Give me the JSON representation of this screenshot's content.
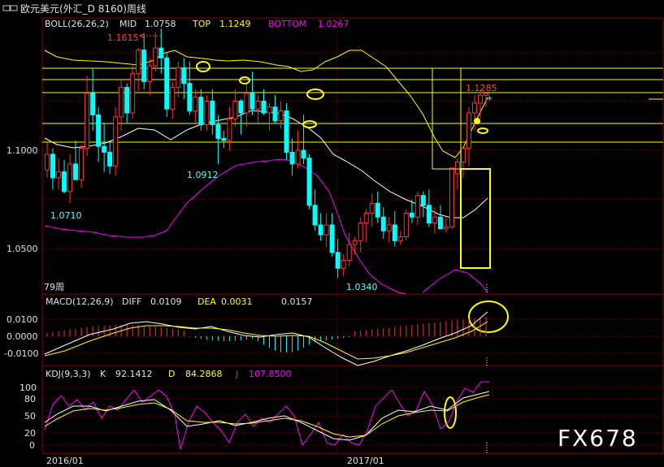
{
  "window": {
    "title": "欧元美元(外汇_D 8160)周线"
  },
  "boll": {
    "label": "BOLL(26,26,2)",
    "mid_label": "MID",
    "mid_value": "1.0758",
    "top_label": "TOP",
    "top_value": "1.1249",
    "bottom_label": "BOTTOM",
    "bottom_value": "1.0267"
  },
  "macd": {
    "label": "MACD(12,26,9)",
    "diff_label": "DIFF",
    "diff_value": "0.0109",
    "dea_label": "DEA",
    "dea_value": "0.0031",
    "macd_value": "0.0157"
  },
  "kdj": {
    "label": "KDJ(9,3,3)",
    "k_label": "K",
    "k_value": "92.1412",
    "d_label": "D",
    "d_value": "84.2868",
    "j_label": "J",
    "j_value": "107.8500"
  },
  "annotations": {
    "high_1": "1.1615",
    "high_2": "1.1285",
    "low_1": "1.0912",
    "low_2": "1.0710",
    "low_3": "1.0340",
    "period_count": "79周"
  },
  "axis": {
    "price_ticks": [
      "1.1000",
      "1.0500"
    ],
    "macd_ticks": [
      "0.0100",
      "0.0000",
      "-0.0100"
    ],
    "kdj_ticks": [
      "100",
      "80",
      "50",
      "20",
      "0"
    ],
    "date_labels": [
      "2016/01",
      "2017/01"
    ]
  },
  "watermark": "FX678",
  "colors": {
    "up": "#ff3232",
    "down": "#00ffff",
    "mid": "#ffffff",
    "top_band": "#ffff00",
    "bottom_band": "#ff00ff",
    "label_cyan": "#54ffff",
    "label_red": "#ff4040",
    "annotation_yellow": "#ffff00"
  },
  "chart_data": {
    "type": "candlestick",
    "title": "欧元美元(外汇_D 8160)周线",
    "period": "weekly",
    "price_ylim": [
      1.02,
      1.17
    ],
    "x_labels": [
      "2016/01",
      "2017/01"
    ],
    "candles": [
      [
        1.09,
        1.104,
        1.086,
        1.098
      ],
      [
        1.098,
        1.101,
        1.08,
        1.086
      ],
      [
        1.086,
        1.096,
        1.08,
        1.089
      ],
      [
        1.089,
        1.095,
        1.078,
        1.079
      ],
      [
        1.079,
        1.098,
        1.073,
        1.093
      ],
      [
        1.093,
        1.105,
        1.085,
        1.085
      ],
      [
        1.085,
        1.103,
        1.081,
        1.101
      ],
      [
        1.101,
        1.138,
        1.097,
        1.129
      ],
      [
        1.129,
        1.142,
        1.11,
        1.118
      ],
      [
        1.118,
        1.122,
        1.094,
        1.102
      ],
      [
        1.102,
        1.114,
        1.089,
        1.099
      ],
      [
        1.099,
        1.104,
        1.088,
        1.092
      ],
      [
        1.092,
        1.122,
        1.087,
        1.117
      ],
      [
        1.117,
        1.136,
        1.11,
        1.132
      ],
      [
        1.132,
        1.134,
        1.114,
        1.119
      ],
      [
        1.119,
        1.144,
        1.116,
        1.139
      ],
      [
        1.139,
        1.152,
        1.13,
        1.151
      ],
      [
        1.151,
        1.159,
        1.131,
        1.135
      ],
      [
        1.135,
        1.147,
        1.128,
        1.143
      ],
      [
        1.143,
        1.16,
        1.14,
        1.152
      ],
      [
        1.152,
        1.162,
        1.139,
        1.147
      ],
      [
        1.147,
        1.15,
        1.117,
        1.121
      ],
      [
        1.121,
        1.135,
        1.116,
        1.132
      ],
      [
        1.132,
        1.145,
        1.127,
        1.142
      ],
      [
        1.142,
        1.147,
        1.126,
        1.134
      ],
      [
        1.134,
        1.145,
        1.118,
        1.12
      ],
      [
        1.12,
        1.131,
        1.114,
        1.127
      ],
      [
        1.127,
        1.131,
        1.11,
        1.113
      ],
      [
        1.113,
        1.128,
        1.11,
        1.125
      ],
      [
        1.125,
        1.131,
        1.108,
        1.113
      ],
      [
        1.113,
        1.118,
        1.093,
        1.106
      ],
      [
        1.106,
        1.11,
        1.101,
        1.105
      ],
      [
        1.105,
        1.122,
        1.1,
        1.116
      ],
      [
        1.116,
        1.131,
        1.112,
        1.125
      ],
      [
        1.125,
        1.126,
        1.108,
        1.119
      ],
      [
        1.119,
        1.134,
        1.112,
        1.129
      ],
      [
        1.129,
        1.14,
        1.118,
        1.121
      ],
      [
        1.121,
        1.128,
        1.113,
        1.125
      ],
      [
        1.125,
        1.131,
        1.118,
        1.119
      ],
      [
        1.119,
        1.124,
        1.11,
        1.122
      ],
      [
        1.122,
        1.128,
        1.114,
        1.115
      ],
      [
        1.115,
        1.125,
        1.111,
        1.12
      ],
      [
        1.12,
        1.124,
        1.095,
        1.099
      ],
      [
        1.099,
        1.106,
        1.087,
        1.093
      ],
      [
        1.093,
        1.11,
        1.091,
        1.1
      ],
      [
        1.1,
        1.118,
        1.093,
        1.096
      ],
      [
        1.096,
        1.098,
        1.07,
        1.072
      ],
      [
        1.072,
        1.08,
        1.059,
        1.062
      ],
      [
        1.062,
        1.068,
        1.054,
        1.057
      ],
      [
        1.057,
        1.068,
        1.051,
        1.062
      ],
      [
        1.062,
        1.068,
        1.046,
        1.048
      ],
      [
        1.048,
        1.055,
        1.035,
        1.04
      ],
      [
        1.04,
        1.047,
        1.036,
        1.044
      ],
      [
        1.044,
        1.058,
        1.041,
        1.052
      ],
      [
        1.052,
        1.056,
        1.047,
        1.054
      ],
      [
        1.054,
        1.066,
        1.048,
        1.063
      ],
      [
        1.063,
        1.07,
        1.053,
        1.068
      ],
      [
        1.068,
        1.078,
        1.061,
        1.073
      ],
      [
        1.073,
        1.079,
        1.063,
        1.066
      ],
      [
        1.066,
        1.071,
        1.055,
        1.059
      ],
      [
        1.059,
        1.066,
        1.053,
        1.062
      ],
      [
        1.062,
        1.069,
        1.051,
        1.054
      ],
      [
        1.054,
        1.059,
        1.052,
        1.056
      ],
      [
        1.056,
        1.07,
        1.054,
        1.068
      ],
      [
        1.068,
        1.075,
        1.063,
        1.066
      ],
      [
        1.066,
        1.079,
        1.062,
        1.077
      ],
      [
        1.077,
        1.079,
        1.066,
        1.072
      ],
      [
        1.072,
        1.08,
        1.061,
        1.063
      ],
      [
        1.063,
        1.071,
        1.058,
        1.066
      ],
      [
        1.066,
        1.072,
        1.06,
        1.06
      ],
      [
        1.06,
        1.066,
        1.058,
        1.061
      ],
      [
        1.061,
        1.084,
        1.06,
        1.091
      ],
      [
        1.088,
        1.096,
        1.08,
        1.094
      ],
      [
        1.094,
        1.101,
        1.086,
        1.101
      ],
      [
        1.101,
        1.122,
        1.092,
        1.119
      ],
      [
        1.119,
        1.128,
        1.11,
        1.124
      ],
      [
        1.124,
        1.131,
        1.116,
        1.128
      ],
      [
        1.128,
        1.129,
        1.122,
        1.129
      ]
    ]
  }
}
